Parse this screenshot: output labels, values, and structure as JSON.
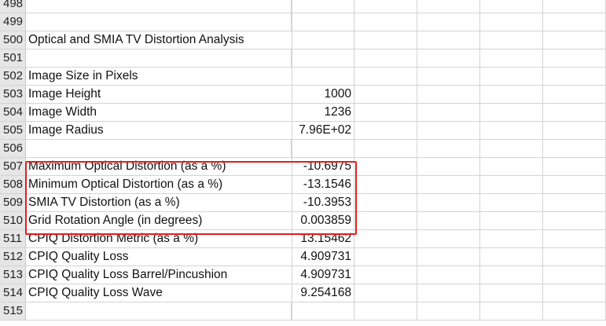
{
  "sheet": {
    "rows": [
      {
        "num": "498",
        "label": "",
        "value": ""
      },
      {
        "num": "499",
        "label": "",
        "value": ""
      },
      {
        "num": "500",
        "label": "Optical and SMIA TV Distortion Analysis",
        "value": ""
      },
      {
        "num": "501",
        "label": "",
        "value": ""
      },
      {
        "num": "502",
        "label": "Image Size in Pixels",
        "value": ""
      },
      {
        "num": "503",
        "label": "Image Height",
        "value": "1000"
      },
      {
        "num": "504",
        "label": "Image Width",
        "value": "1236"
      },
      {
        "num": "505",
        "label": "Image Radius",
        "value": "7.96E+02"
      },
      {
        "num": "506",
        "label": "",
        "value": ""
      },
      {
        "num": "507",
        "label": "Maximum Optical Distortion (as a %)",
        "value": "-10.6975"
      },
      {
        "num": "508",
        "label": "Minimum Optical Distortion (as a %)",
        "value": "-13.1546"
      },
      {
        "num": "509",
        "label": "SMIA TV Distortion (as a %)",
        "value": "-10.3953"
      },
      {
        "num": "510",
        "label": "Grid Rotation Angle (in degrees)",
        "value": "0.003859"
      },
      {
        "num": "511",
        "label": "CPIQ Distortion Metric (as a %)",
        "value": "13.15462"
      },
      {
        "num": "512",
        "label": "CPIQ Quality Loss",
        "value": "4.909731"
      },
      {
        "num": "513",
        "label": "CPIQ Quality Loss Barrel/Pincushion",
        "value": "4.909731"
      },
      {
        "num": "514",
        "label": "CPIQ Quality Loss Wave",
        "value": "9.254168"
      },
      {
        "num": "515",
        "label": "",
        "value": ""
      }
    ]
  },
  "highlight": {
    "color": "#e51c1c",
    "first_row": "507",
    "last_row": "510"
  }
}
